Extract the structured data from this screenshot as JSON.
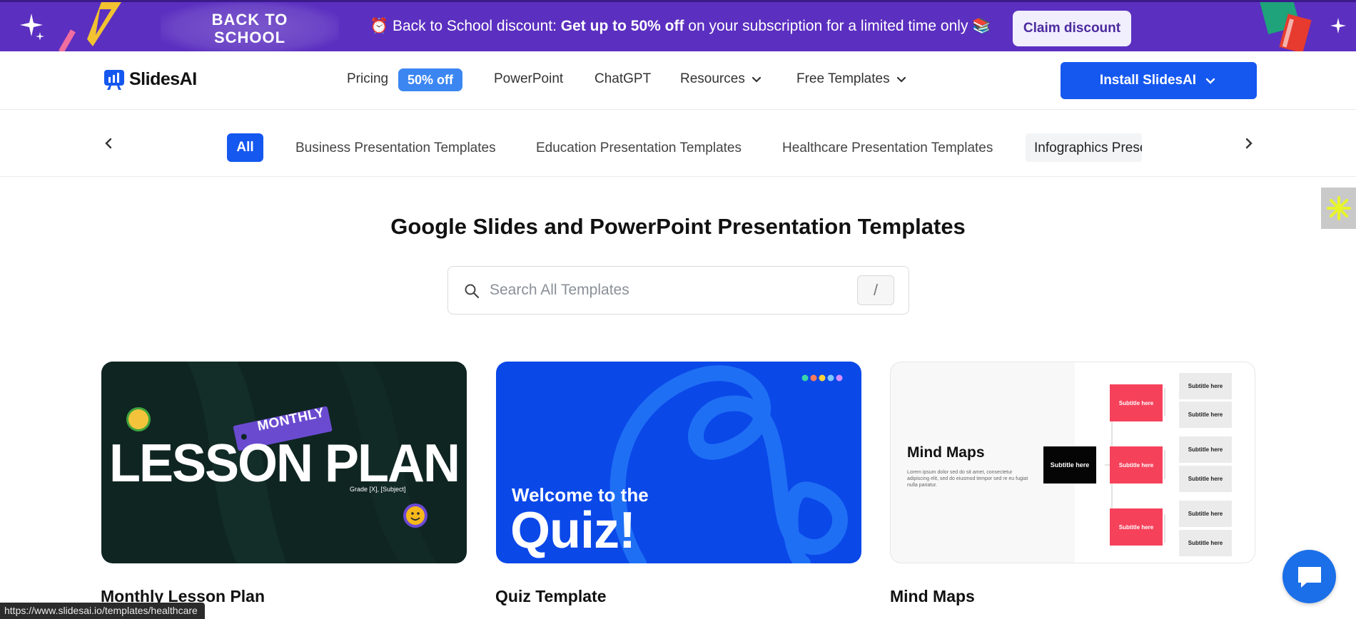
{
  "banner": {
    "back_to_school": "BACK TO SCHOOL",
    "promo_prefix": "⏰ Back to School discount: ",
    "promo_bold": "Get up to 50% off",
    "promo_suffix": " on your subscription for a limited time only 📚",
    "claim_label": "Claim discount"
  },
  "header": {
    "logo_text": "SlidesAI",
    "nav": {
      "pricing": "Pricing",
      "pricing_badge": "50% off",
      "powerpoint": "PowerPoint",
      "chatgpt": "ChatGPT",
      "resources": "Resources",
      "free_templates": "Free Templates"
    },
    "install_label": "Install SlidesAI"
  },
  "categories": {
    "active": "All",
    "items": [
      "Business Presentation Templates",
      "Education Presentation Templates",
      "Healthcare Presentation Templates",
      "Infographics Presentation Templates"
    ]
  },
  "main": {
    "title": "Google Slides and PowerPoint Presentation Templates",
    "search_placeholder": "Search All Templates",
    "search_shortcut": "/"
  },
  "cards": [
    {
      "title": "Monthly Lesson Plan",
      "thumb": {
        "tag": "MONTHLY",
        "headline": "LESSON PLAN",
        "sub": "Grade [X], [Subject]"
      }
    },
    {
      "title": "Quiz Template",
      "thumb": {
        "line1": "Welcome to the",
        "line2": "Quiz!"
      }
    },
    {
      "title": "Mind Maps",
      "thumb": {
        "heading": "Mind Maps",
        "body": "Lorem ipsum dolor sed do sit amet, consectetur adipiscing elit, sed do eiusmod tempor sed re eu fugiat nulla pariatur.",
        "center_label": "Subtitle here",
        "branch_label": "Subtitle here",
        "leaf_label": "Subtitle here"
      }
    }
  ],
  "status_url": "https://www.slidesai.io/templates/healthcare",
  "colors": {
    "banner": "#5b2fc0",
    "primary": "#1558f0",
    "badge": "#3c86f2",
    "quiz_bg": "#0a48e8",
    "lesson_bg": "#0f2522",
    "mind_red": "#f6415b"
  }
}
